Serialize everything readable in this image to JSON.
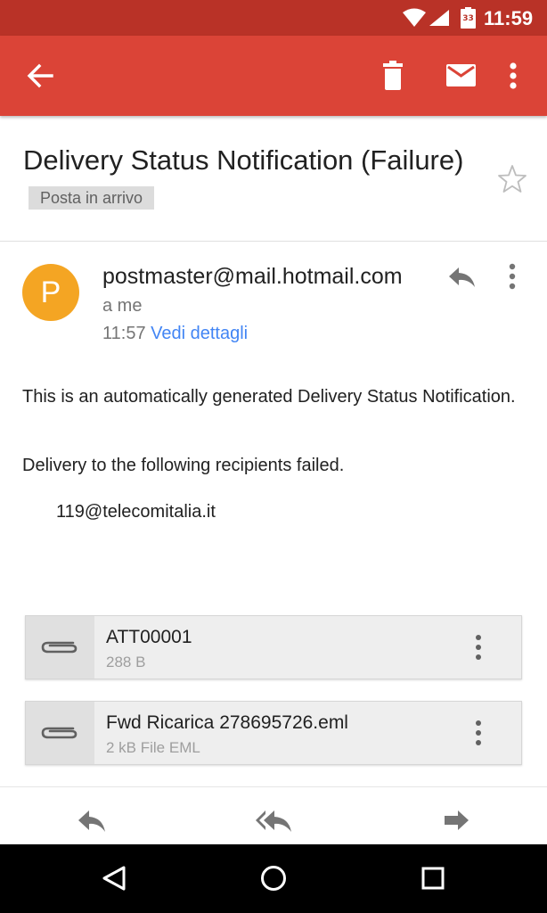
{
  "status_bar": {
    "time": "11:59",
    "battery_level": "33",
    "icons": [
      "wifi-icon",
      "cell-signal-icon",
      "battery-icon"
    ]
  },
  "toolbar": {
    "icons": [
      "back-arrow-icon",
      "trash-icon",
      "mail-icon",
      "more-vert-icon"
    ],
    "background": "#db4437"
  },
  "message": {
    "subject": "Delivery Status Notification (Failure)",
    "label": "Posta in arrivo",
    "sender_initial": "P",
    "sender": "postmaster@mail.hotmail.com",
    "recipient": "a me",
    "time": "11:57",
    "details_link": "Vedi dettagli",
    "avatar_color": "#f4a523",
    "link_color": "#4285f4",
    "body": {
      "p1": "This is an automatically generated Delivery Status Notification.",
      "p2": "Delivery to the following recipients failed.",
      "p3": "119@telecomitalia.it"
    }
  },
  "attachments": [
    {
      "name": "ATT00001",
      "meta": "288 B"
    },
    {
      "name": "Fwd Ricarica 278695726.eml",
      "meta": "2 kB File EML"
    }
  ],
  "bottom_actions": [
    "reply-icon",
    "reply-all-icon",
    "forward-icon"
  ],
  "nav_bar": [
    "back-triangle-icon",
    "home-circle-icon",
    "recents-square-icon"
  ]
}
